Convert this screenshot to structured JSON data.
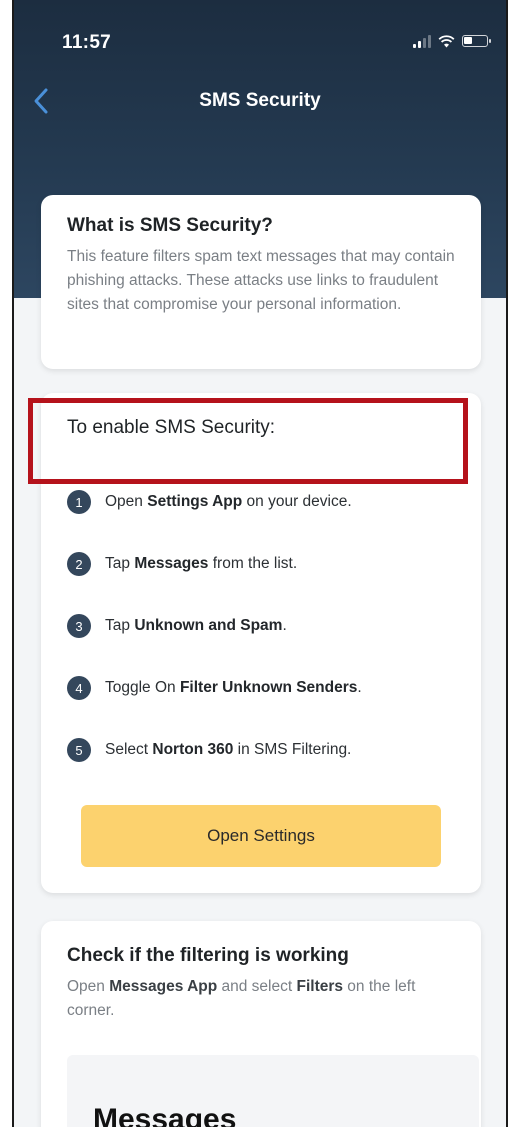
{
  "status_bar": {
    "time": "11:57"
  },
  "nav": {
    "title": "SMS Security"
  },
  "info_card": {
    "title": "What is SMS Security?",
    "description": "This feature filters spam text messages that may contain phishing attacks. These attacks use links to fraudulent sites that compromise your personal information."
  },
  "enable_card": {
    "title": "To enable SMS Security:",
    "steps": [
      {
        "num": "1",
        "pre": "Open ",
        "bold": "Settings App",
        "post": " on your device."
      },
      {
        "num": "2",
        "pre": "Tap ",
        "bold": "Messages",
        "post": " from the list."
      },
      {
        "num": "3",
        "pre": "Tap ",
        "bold": "Unknown and Spam",
        "post": "."
      },
      {
        "num": "4",
        "pre": "Toggle On ",
        "bold": "Filter Unknown Senders",
        "post": "."
      },
      {
        "num": "5",
        "pre": "Select ",
        "bold": "Norton 360",
        "post": " in SMS Filtering."
      }
    ],
    "button_label": "Open Settings"
  },
  "check_card": {
    "title": "Check if the filtering is working",
    "desc_pre": "Open ",
    "desc_bold1": "Messages App",
    "desc_mid": " and select ",
    "desc_bold2": "Filters",
    "desc_post": " on the left corner.",
    "preview_title": "Messages"
  },
  "colors": {
    "header": "#1c2d40",
    "button": "#fcd26e",
    "step_badge": "#34475c",
    "highlight_border": "#b5121b"
  }
}
